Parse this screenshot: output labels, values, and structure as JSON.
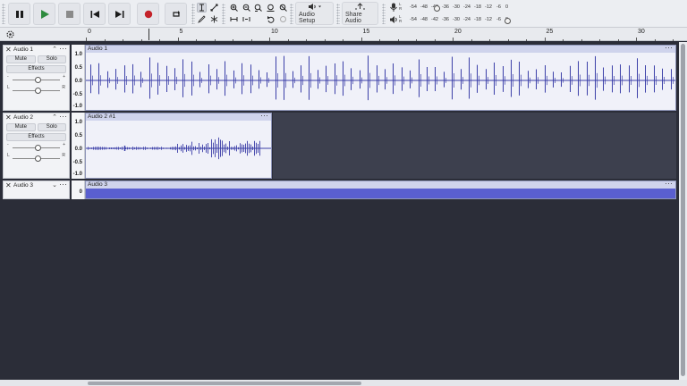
{
  "toolbar": {
    "transport": [
      {
        "name": "pause-icon",
        "accent": "#1b1b1b"
      },
      {
        "name": "play-icon",
        "accent": "#2e8b3e"
      },
      {
        "name": "stop-icon",
        "accent": "#7a7a7a"
      },
      {
        "name": "skip-to-start-icon",
        "accent": "#1b1b1b"
      },
      {
        "name": "skip-to-end-icon",
        "accent": "#1b1b1b"
      },
      {
        "name": "record-icon",
        "accent": "#c4222a"
      },
      {
        "name": "loop-icon",
        "accent": "#1b1b1b"
      }
    ],
    "audio_setup_label": "Audio Setup",
    "share_audio_label": "Share Audio",
    "meter": {
      "record_lr": [
        "L",
        "R"
      ],
      "play_lr": [
        "L",
        "R"
      ],
      "record_ticks": [
        "-54",
        "-48",
        "-42",
        "-36",
        "-30",
        "-24",
        "-18",
        "-12",
        "-6",
        "0"
      ],
      "play_ticks": [
        "-54",
        "-48",
        "-42",
        "-36",
        "-30",
        "-24",
        "-18",
        "-12",
        "-6",
        "0"
      ]
    }
  },
  "ruler": {
    "labels": [
      "0",
      "5",
      "10",
      "15",
      "20",
      "25",
      "30"
    ]
  },
  "tracks": [
    {
      "name": "Audio 1",
      "mute_label": "Mute",
      "solo_label": "Solo",
      "effects_label": "Effects",
      "gain_left": "-",
      "gain_right": "+",
      "pan_left": "L",
      "pan_right": "R",
      "scale": [
        "1.0",
        "0.5",
        "0.0",
        "-0.5",
        "-1.0"
      ],
      "clip_name": "Audio 1"
    },
    {
      "name": "Audio 2",
      "mute_label": "Mute",
      "solo_label": "Solo",
      "effects_label": "Effects",
      "gain_left": "-",
      "gain_right": "+",
      "pan_left": "L",
      "pan_right": "R",
      "scale": [
        "1.0",
        "0.5",
        "0.0",
        "-0.5",
        "-1.0"
      ],
      "clip_name": "Audio 2 #1"
    },
    {
      "name": "Audio 3",
      "scale": [
        "0"
      ],
      "clip_name": "Audio 3"
    }
  ],
  "colors": {
    "waveform": "#3b3fa8",
    "clip_header": "#cfd3ec",
    "clip_body": "#f0f1f9",
    "track_bg": "#2b2d38",
    "collapsed_clip": "#5a5fd0"
  }
}
